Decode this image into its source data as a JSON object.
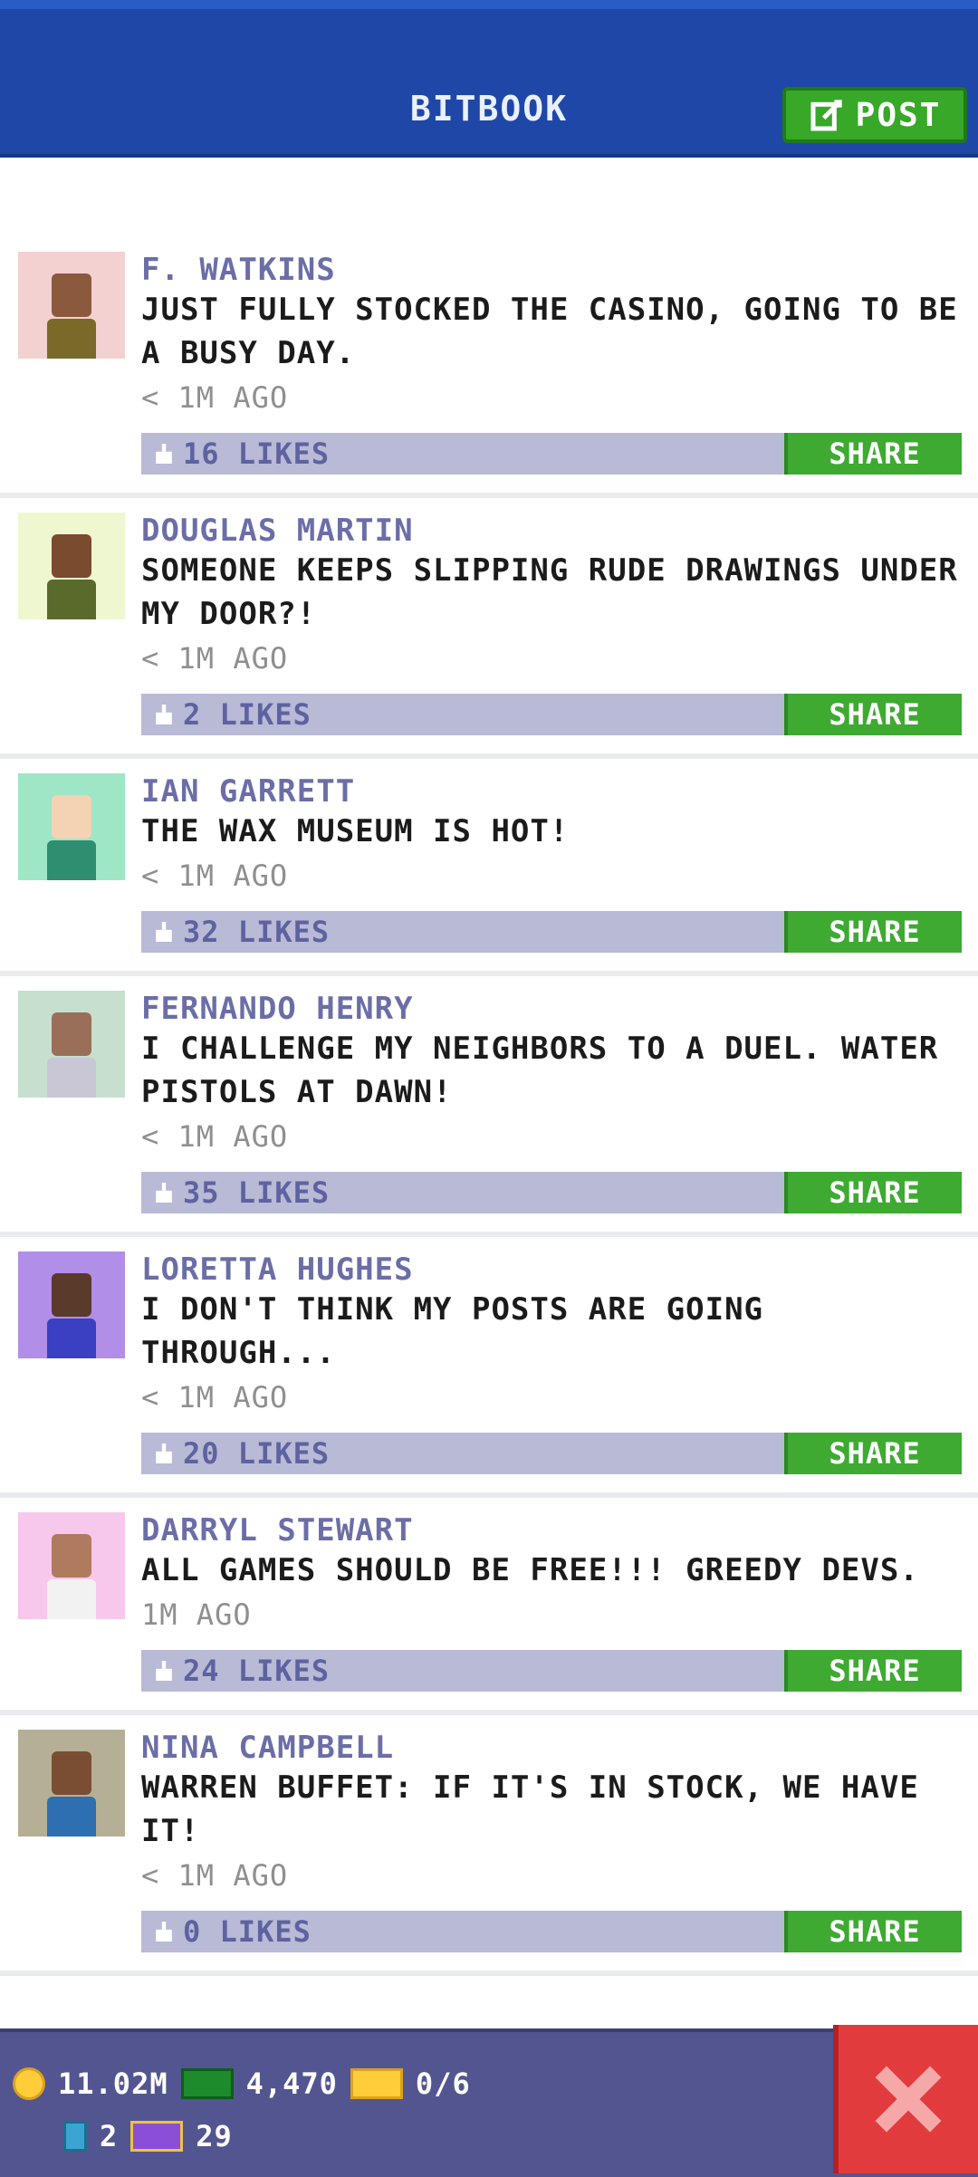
{
  "header": {
    "title": "BITBOOK",
    "post_label": "POST"
  },
  "colors": {
    "header_bg": "#1f47a8",
    "author": "#6b6ea6",
    "share_green": "#3eaa32",
    "like_bar": "#b8bad6",
    "bottom_bar": "#535591",
    "close_red": "#e23b3e"
  },
  "posts": [
    {
      "author": "F. WATKINS",
      "text": "JUST FULLY STOCKED THE CASINO, GOING TO BE A BUSY DAY.",
      "time": "< 1M AGO",
      "likes": "16 LIKES",
      "share": "SHARE",
      "avatar_bg": "#f3d1d1",
      "skin": "#8b5a3c",
      "shirt": "#7a6a2a"
    },
    {
      "author": "DOUGLAS MARTIN",
      "text": "SOMEONE KEEPS SLIPPING RUDE DRAWINGS UNDER MY DOOR?!",
      "time": "< 1M AGO",
      "likes": "2 LIKES",
      "share": "SHARE",
      "avatar_bg": "#eef7cf",
      "skin": "#7a4b2e",
      "shirt": "#5a6a2a"
    },
    {
      "author": "IAN GARRETT",
      "text": "THE WAX MUSEUM IS HOT!",
      "time": "< 1M AGO",
      "likes": "32 LIKES",
      "share": "SHARE",
      "avatar_bg": "#9fe6c6",
      "skin": "#f3d3b3",
      "shirt": "#2f8e6f"
    },
    {
      "author": "FERNANDO HENRY",
      "text": "I CHALLENGE MY NEIGHBORS TO A DUEL. WATER PISTOLS AT DAWN!",
      "time": "< 1M AGO",
      "likes": "35 LIKES",
      "share": "SHARE",
      "avatar_bg": "#c7dfcf",
      "skin": "#9a6f5a",
      "shirt": "#c9c6d6"
    },
    {
      "author": "LORETTA HUGHES",
      "text": "I DON'T THINK MY POSTS ARE GOING THROUGH...",
      "time": "< 1M AGO",
      "likes": "20 LIKES",
      "share": "SHARE",
      "avatar_bg": "#b18ee8",
      "skin": "#5a3a2a",
      "shirt": "#3b3fc2"
    },
    {
      "author": "DARRYL STEWART",
      "text": "ALL GAMES SHOULD BE FREE!!! GREEDY DEVS.",
      "time": "1M AGO",
      "likes": "24 LIKES",
      "share": "SHARE",
      "avatar_bg": "#f8c7ec",
      "skin": "#b07a5f",
      "shirt": "#f2f2f2"
    },
    {
      "author": "NINA CAMPBELL",
      "text": "WARREN BUFFET: IF IT'S IN STOCK, WE HAVE IT!",
      "time": "< 1M AGO",
      "likes": "0 LIKES",
      "share": "SHARE",
      "avatar_bg": "#b5af95",
      "skin": "#7a4e33",
      "shirt": "#2e6fb1"
    }
  ],
  "bottom": {
    "coins": "11.02M",
    "cash": "4,470",
    "tickets": "0/6",
    "bux": "2",
    "tv": "29"
  }
}
